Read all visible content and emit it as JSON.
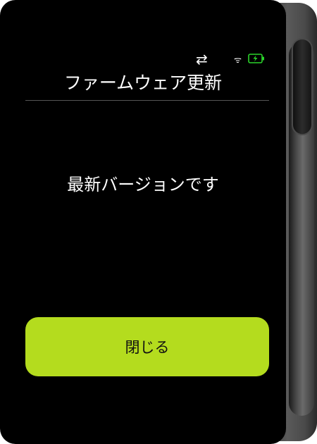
{
  "status": {
    "sync_icon": "⇄",
    "wifi_icon": "ᯤ",
    "battery_icon": "battery-charging-icon",
    "battery_color": "#2ad42a"
  },
  "screen": {
    "title": "ファームウェア更新",
    "message": "最新バージョンです",
    "close_button_label": "閉じる"
  },
  "colors": {
    "button_bg": "#b4dc1e",
    "screen_bg": "#000000"
  }
}
